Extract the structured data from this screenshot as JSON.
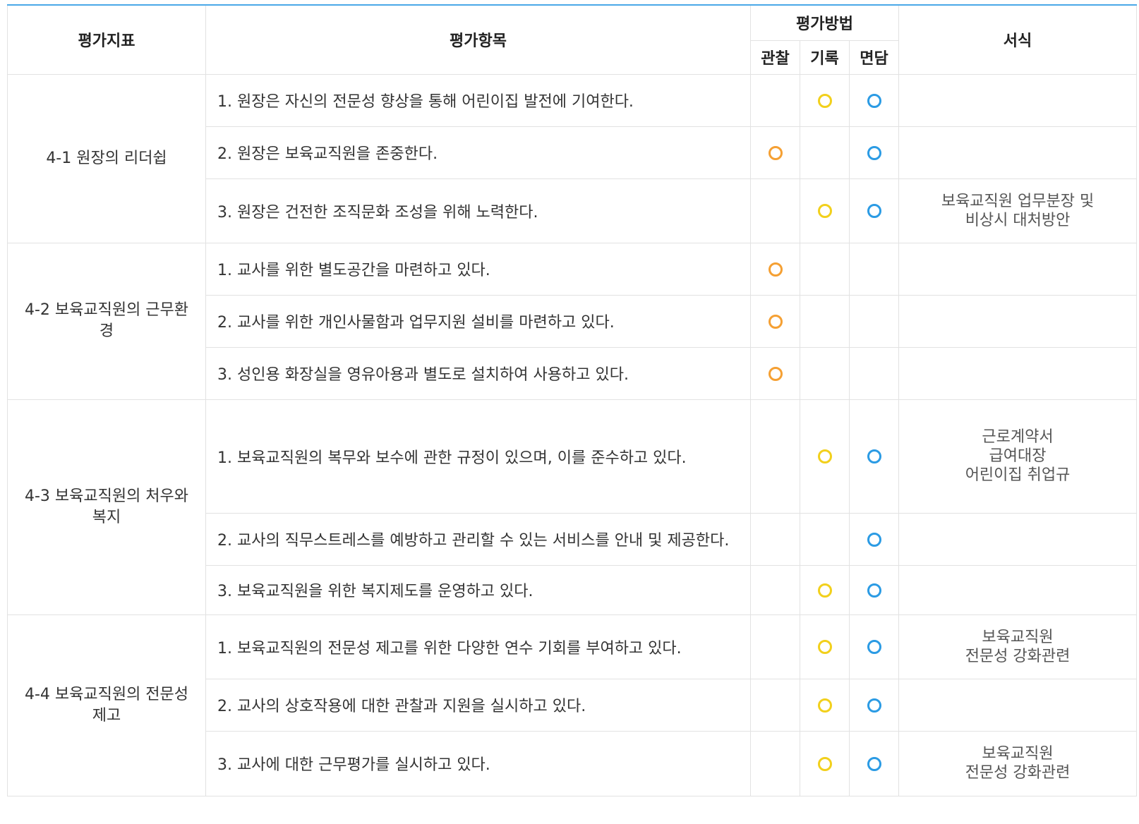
{
  "colors": {
    "observation_circle": "#f5a033",
    "record_circle": "#f2d01c",
    "interview_circle": "#2b9be4",
    "header_top_border": "#4aa8e8"
  },
  "header": {
    "indicator": "평가지표",
    "item": "평가항목",
    "method": "평가방법",
    "observation": "관찰",
    "record": "기록",
    "interview": "면담",
    "form": "서식"
  },
  "groups": [
    {
      "indicator": "4-1 원장의 리더쉽",
      "rows": [
        {
          "item": "1. 원장은 자신의 전문성 향상을 통해 어린이집 발전에 기여한다.",
          "observation": false,
          "record": true,
          "interview": true,
          "form": []
        },
        {
          "item": "2. 원장은 보육교직원을 존중한다.",
          "observation": true,
          "record": false,
          "interview": true,
          "form": []
        },
        {
          "item": "3. 원장은 건전한 조직문화 조성을 위해 노력한다.",
          "observation": false,
          "record": true,
          "interview": true,
          "form": [
            "보육교직원 업무분장 및",
            "비상시 대처방안"
          ]
        }
      ]
    },
    {
      "indicator": "4-2 보육교직원의 근무환경",
      "rows": [
        {
          "item": "1. 교사를 위한 별도공간을 마련하고 있다.",
          "observation": true,
          "record": false,
          "interview": false,
          "form": []
        },
        {
          "item": "2. 교사를 위한 개인사물함과 업무지원 설비를 마련하고 있다.",
          "observation": true,
          "record": false,
          "interview": false,
          "form": []
        },
        {
          "item": "3. 성인용 화장실을 영유아용과 별도로 설치하여 사용하고 있다.",
          "observation": true,
          "record": false,
          "interview": false,
          "form": []
        }
      ]
    },
    {
      "indicator": "4-3 보육교직원의 처우와 복지",
      "rows": [
        {
          "item": "1. 보육교직원의 복무와 보수에 관한 규정이 있으며, 이를 준수하고 있다.",
          "observation": false,
          "record": true,
          "interview": true,
          "form": [
            "근로계약서",
            "급여대장",
            "어린이집 취업규"
          ]
        },
        {
          "item": "2. 교사의 직무스트레스를 예방하고 관리할 수 있는 서비스를 안내 및 제공한다.",
          "observation": false,
          "record": false,
          "interview": true,
          "form": []
        },
        {
          "item": "3. 보육교직원을 위한 복지제도를 운영하고 있다.",
          "observation": false,
          "record": true,
          "interview": true,
          "form": []
        }
      ]
    },
    {
      "indicator": "4-4 보육교직원의 전문성 제고",
      "rows": [
        {
          "item": "1. 보육교직원의 전문성 제고를 위한 다양한 연수 기회를 부여하고 있다.",
          "observation": false,
          "record": true,
          "interview": true,
          "form": [
            "보육교직원",
            "전문성 강화관련"
          ]
        },
        {
          "item": "2. 교사의 상호작용에 대한 관찰과 지원을 실시하고 있다.",
          "observation": false,
          "record": true,
          "interview": true,
          "form": []
        },
        {
          "item": "3. 교사에 대한 근무평가를 실시하고 있다.",
          "observation": false,
          "record": true,
          "interview": true,
          "form": [
            "보육교직원",
            "전문성 강화관련"
          ]
        }
      ]
    }
  ]
}
